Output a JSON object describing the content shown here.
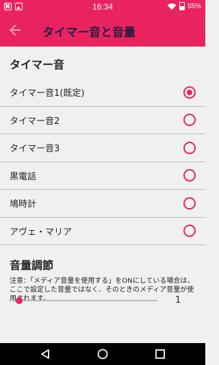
{
  "status_bar": {
    "time": "16:34",
    "battery": "55%",
    "left_icons": [
      "close-box-icon",
      "image-icon"
    ],
    "right_icons": [
      "wifi-icon",
      "battery-icon"
    ]
  },
  "app_bar": {
    "title": "タイマー音と音量",
    "back_icon": "back-arrow-icon"
  },
  "timer_section": {
    "header": "タイマー音",
    "options": [
      {
        "label": "タイマー音1(既定)",
        "selected": true
      },
      {
        "label": "タイマー音2",
        "selected": false
      },
      {
        "label": "タイマー音3",
        "selected": false
      },
      {
        "label": "黒電話",
        "selected": false
      },
      {
        "label": "鳩時計",
        "selected": false
      },
      {
        "label": "アヴェ・マリア",
        "selected": false
      }
    ]
  },
  "volume_section": {
    "header": "音量調節",
    "note": "注意：「メディア音量を使用する」をONにしている場合は、ここで設定した音量ではなく、そのときのメディア音量が使用されます。",
    "slider_fraction": 0.0,
    "value": "1"
  },
  "nav_bar": {
    "buttons": [
      "back-triangle-icon",
      "home-circle-icon",
      "recents-square-icon"
    ]
  },
  "colors": {
    "accent": "#e8235f",
    "background": "#f0f0f0",
    "divider": "#bdbdbd",
    "nav_bar": "#000000"
  }
}
